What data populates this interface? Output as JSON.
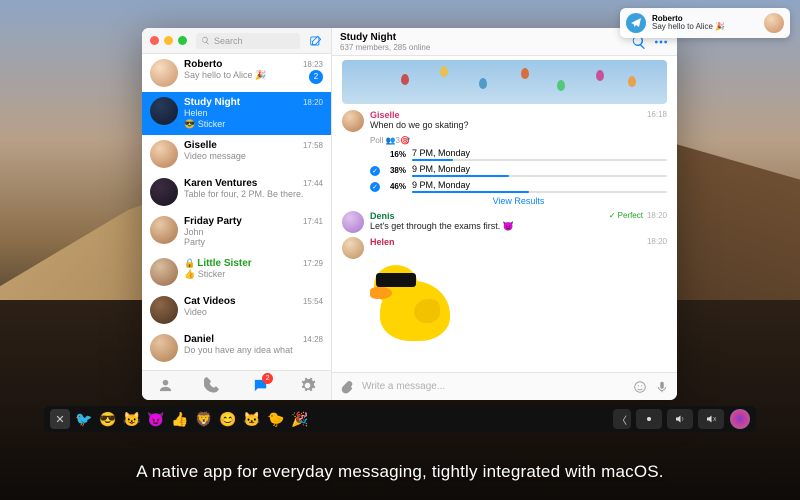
{
  "notification": {
    "sender": "Roberto",
    "text": "Say hello to Alice 🎉"
  },
  "search": {
    "placeholder": "Search"
  },
  "chats": [
    {
      "name": "Roberto",
      "preview": "Say hello to Alice 🎉",
      "time": "18:23",
      "badge": "2",
      "avatar": "av-a"
    },
    {
      "name": "Study Night",
      "preview_line1": "Helen",
      "preview_line2": "😎 Sticker",
      "time": "18:20",
      "avatar": "av-b",
      "selected": true
    },
    {
      "name": "Giselle",
      "preview": "Video message",
      "time": "17:58",
      "avatar": "av-c"
    },
    {
      "name": "Karen Ventures",
      "preview": "Table for four, 2 PM. Be there.",
      "time": "17:44",
      "avatar": "av-d"
    },
    {
      "name": "Friday Party",
      "preview_line1": "John",
      "preview_line2": "Party",
      "time": "17:41",
      "avatar": "av-e"
    },
    {
      "name": "Little Sister",
      "preview": "👍 Sticker",
      "time": "17:29",
      "avatar": "av-f",
      "green": true,
      "lock": true
    },
    {
      "name": "Cat Videos",
      "preview": "Video",
      "time": "15:54",
      "avatar": "av-g"
    },
    {
      "name": "Daniel",
      "preview": "Do you have any idea what",
      "time": "14:28",
      "avatar": "av-h"
    }
  ],
  "bottom_badge": "2",
  "header": {
    "title": "Study Night",
    "subtitle": "637 members, 285 online"
  },
  "poll": {
    "sender": "Giselle",
    "question": "When do we go skating?",
    "subtitle": "Poll   👥3🎯",
    "time": "16:18",
    "options": [
      {
        "pct": "16%",
        "label": "7 PM, Monday",
        "fill": 16,
        "picked": false
      },
      {
        "pct": "38%",
        "label": "9 PM, Monday",
        "fill": 38,
        "picked": true
      },
      {
        "pct": "46%",
        "label": "9 PM, Monday",
        "fill": 46,
        "picked": true
      }
    ],
    "view_results": "View Results"
  },
  "msg2": {
    "sender": "Denis",
    "text": "Let's get through the exams first. 😈",
    "time": "18:20",
    "status": "Perfect"
  },
  "msg3": {
    "sender": "Helen",
    "time": "18:20"
  },
  "input": {
    "placeholder": "Write a message..."
  },
  "caption": "A native app for everyday messaging, tightly integrated with macOS.",
  "touchbar_stickers": [
    "🐦",
    "😎",
    "😺",
    "😈",
    "👍",
    "🦁",
    "😊",
    "🐱",
    "🐤",
    "🎉"
  ]
}
